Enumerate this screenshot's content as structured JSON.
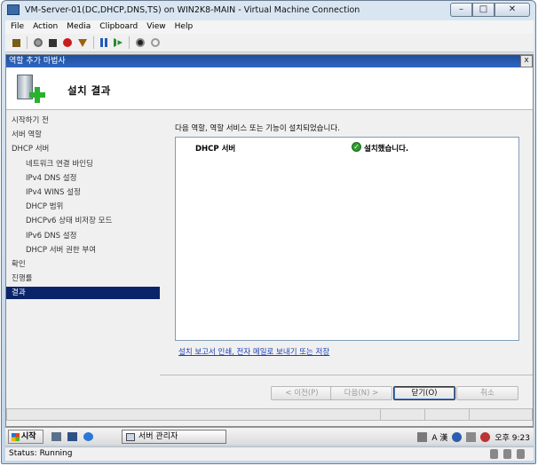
{
  "window": {
    "title": "VM-Server-01(DC,DHCP,DNS,TS) on WIN2K8-MAIN - Virtual Machine Connection",
    "minimize": "–",
    "maximize": "□",
    "close": "✕"
  },
  "menu": [
    "File",
    "Action",
    "Media",
    "Clipboard",
    "View",
    "Help"
  ],
  "wizard": {
    "title": "역할 추가 마법사",
    "close": "x",
    "header_title": "설치 결과",
    "steps": [
      {
        "label": "시작하기 전",
        "level": 0,
        "active": false
      },
      {
        "label": "서버 역할",
        "level": 0,
        "active": false
      },
      {
        "label": "DHCP 서버",
        "level": 0,
        "active": false
      },
      {
        "label": "네트워크 연결 바인딩",
        "level": 1,
        "active": false
      },
      {
        "label": "IPv4 DNS 설정",
        "level": 1,
        "active": false
      },
      {
        "label": "IPv4 WINS 설정",
        "level": 1,
        "active": false
      },
      {
        "label": "DHCP 범위",
        "level": 1,
        "active": false
      },
      {
        "label": "DHCPv6 상태 비저장 모드",
        "level": 1,
        "active": false
      },
      {
        "label": "IPv6 DNS 설정",
        "level": 1,
        "active": false
      },
      {
        "label": "DHCP 서버 권한 부여",
        "level": 1,
        "active": false
      },
      {
        "label": "확인",
        "level": 0,
        "active": false
      },
      {
        "label": "진행률",
        "level": 0,
        "active": false
      },
      {
        "label": "결과",
        "level": 0,
        "active": true
      }
    ],
    "message": "다음 역할, 역할 서비스 또는 기능이 설치되었습니다.",
    "result_role": "DHCP 서버",
    "result_status": "설치했습니다.",
    "report_link": "설치 보고서 인쇄, 전자 메일로 보내기 또는 저장",
    "buttons": {
      "prev": "< 이전(P)",
      "next": "다음(N) >",
      "close": "닫기(O)",
      "cancel": "취소"
    }
  },
  "taskbar": {
    "start": "시작",
    "task_item": "서버 관리자",
    "ime": "A 漢",
    "clock": "오후 9:23"
  },
  "status": "Status: Running"
}
